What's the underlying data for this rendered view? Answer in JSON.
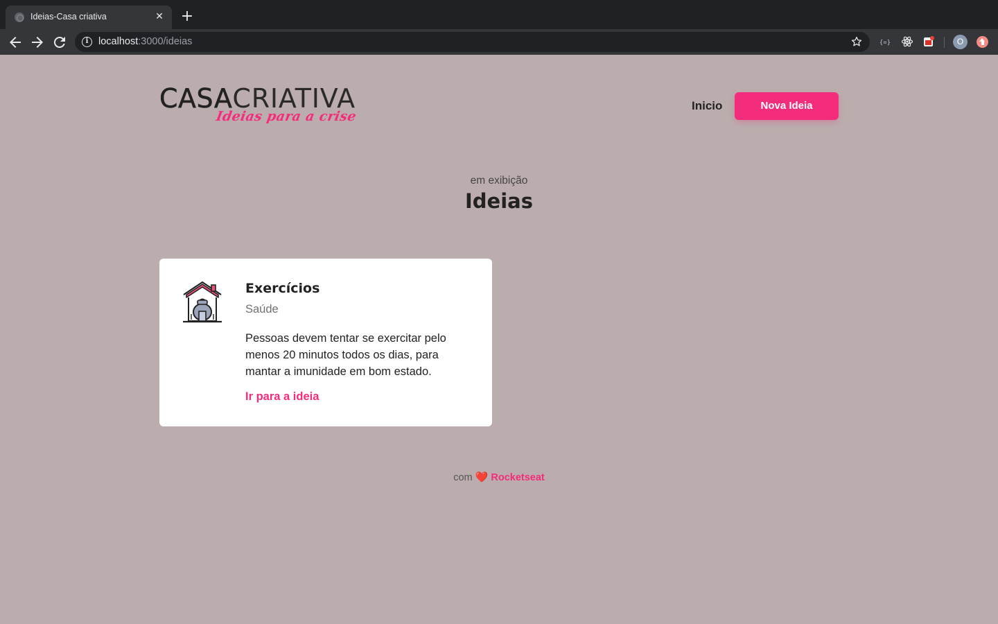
{
  "browser": {
    "tab_title": "Ideias-Casa criativa",
    "tab_close": "✕",
    "new_tab": "+",
    "url_host": "localhost",
    "url_path": ":3000/ideias",
    "avatar_letter": "O"
  },
  "header": {
    "logo_main_bold": "CASA",
    "logo_main_light": "CRIATIVA",
    "logo_tagline": "Ideias para a crise",
    "nav_home": "Inicio",
    "new_idea_button": "Nova Ideia"
  },
  "section": {
    "subtitle": "em exibição",
    "title": "Ideias"
  },
  "ideas": [
    {
      "icon": "home-exercise-icon",
      "title": "Exercícios",
      "category": "Saúde",
      "description": "Pessoas devem tentar se exercitar pelo menos 20 minutos todos os dias, para mantar a imunidade em bom estado.",
      "link_label": "Ir para a ideia"
    }
  ],
  "footer": {
    "prefix": "com",
    "heart": "❤️",
    "brand": "Rocketseat"
  },
  "colors": {
    "background": "#bbadad",
    "accent": "#f42c7c",
    "card": "#ffffff",
    "text": "#222222"
  }
}
